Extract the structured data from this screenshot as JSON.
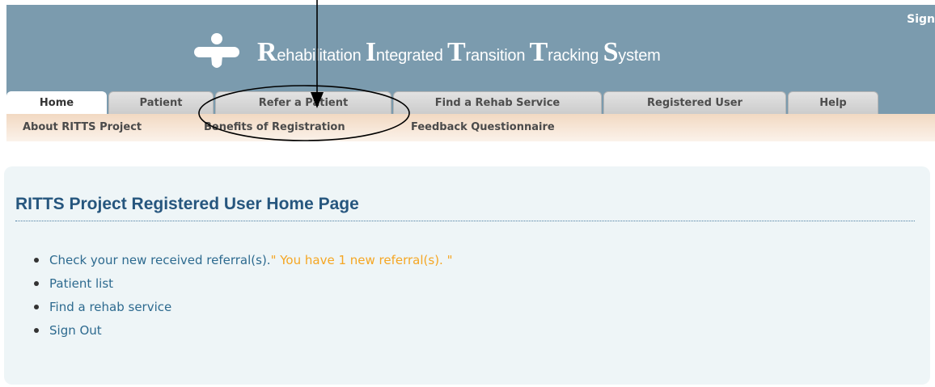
{
  "header": {
    "signout": "Sign",
    "title_parts": [
      {
        "cap": "R",
        "rest": "ehabilitation "
      },
      {
        "cap": "I",
        "rest": "ntegrated "
      },
      {
        "cap": "T",
        "rest": "ransition "
      },
      {
        "cap": "T",
        "rest": "racking "
      },
      {
        "cap": "S",
        "rest": "ystem"
      }
    ]
  },
  "tabs": [
    {
      "label": "Home",
      "active": true
    },
    {
      "label": "Patient",
      "active": false
    },
    {
      "label": "Refer a Patient",
      "active": false
    },
    {
      "label": "Find a Rehab Service",
      "active": false
    },
    {
      "label": "Registered User",
      "active": false
    },
    {
      "label": "Help",
      "active": false
    }
  ],
  "subnav": [
    "About RITTS Project",
    "Benefits of Registration",
    "Feedback Questionnaire"
  ],
  "main": {
    "heading": "RITTS Project Registered User Home Page",
    "links": [
      {
        "label": "Check your new received referral(s).",
        "notice": "\" You have 1 new referral(s). \""
      },
      {
        "label": "Patient list",
        "notice": ""
      },
      {
        "label": "Find a rehab service",
        "notice": ""
      },
      {
        "label": "Sign Out",
        "notice": ""
      }
    ]
  },
  "colors": {
    "header_bg": "#7b9bae",
    "link": "#2d6a8f",
    "notice": "#f5a623",
    "heading": "#26567e"
  },
  "icons": {
    "logo": "plus-person-icon",
    "annotation": "arrow-down-icon"
  }
}
